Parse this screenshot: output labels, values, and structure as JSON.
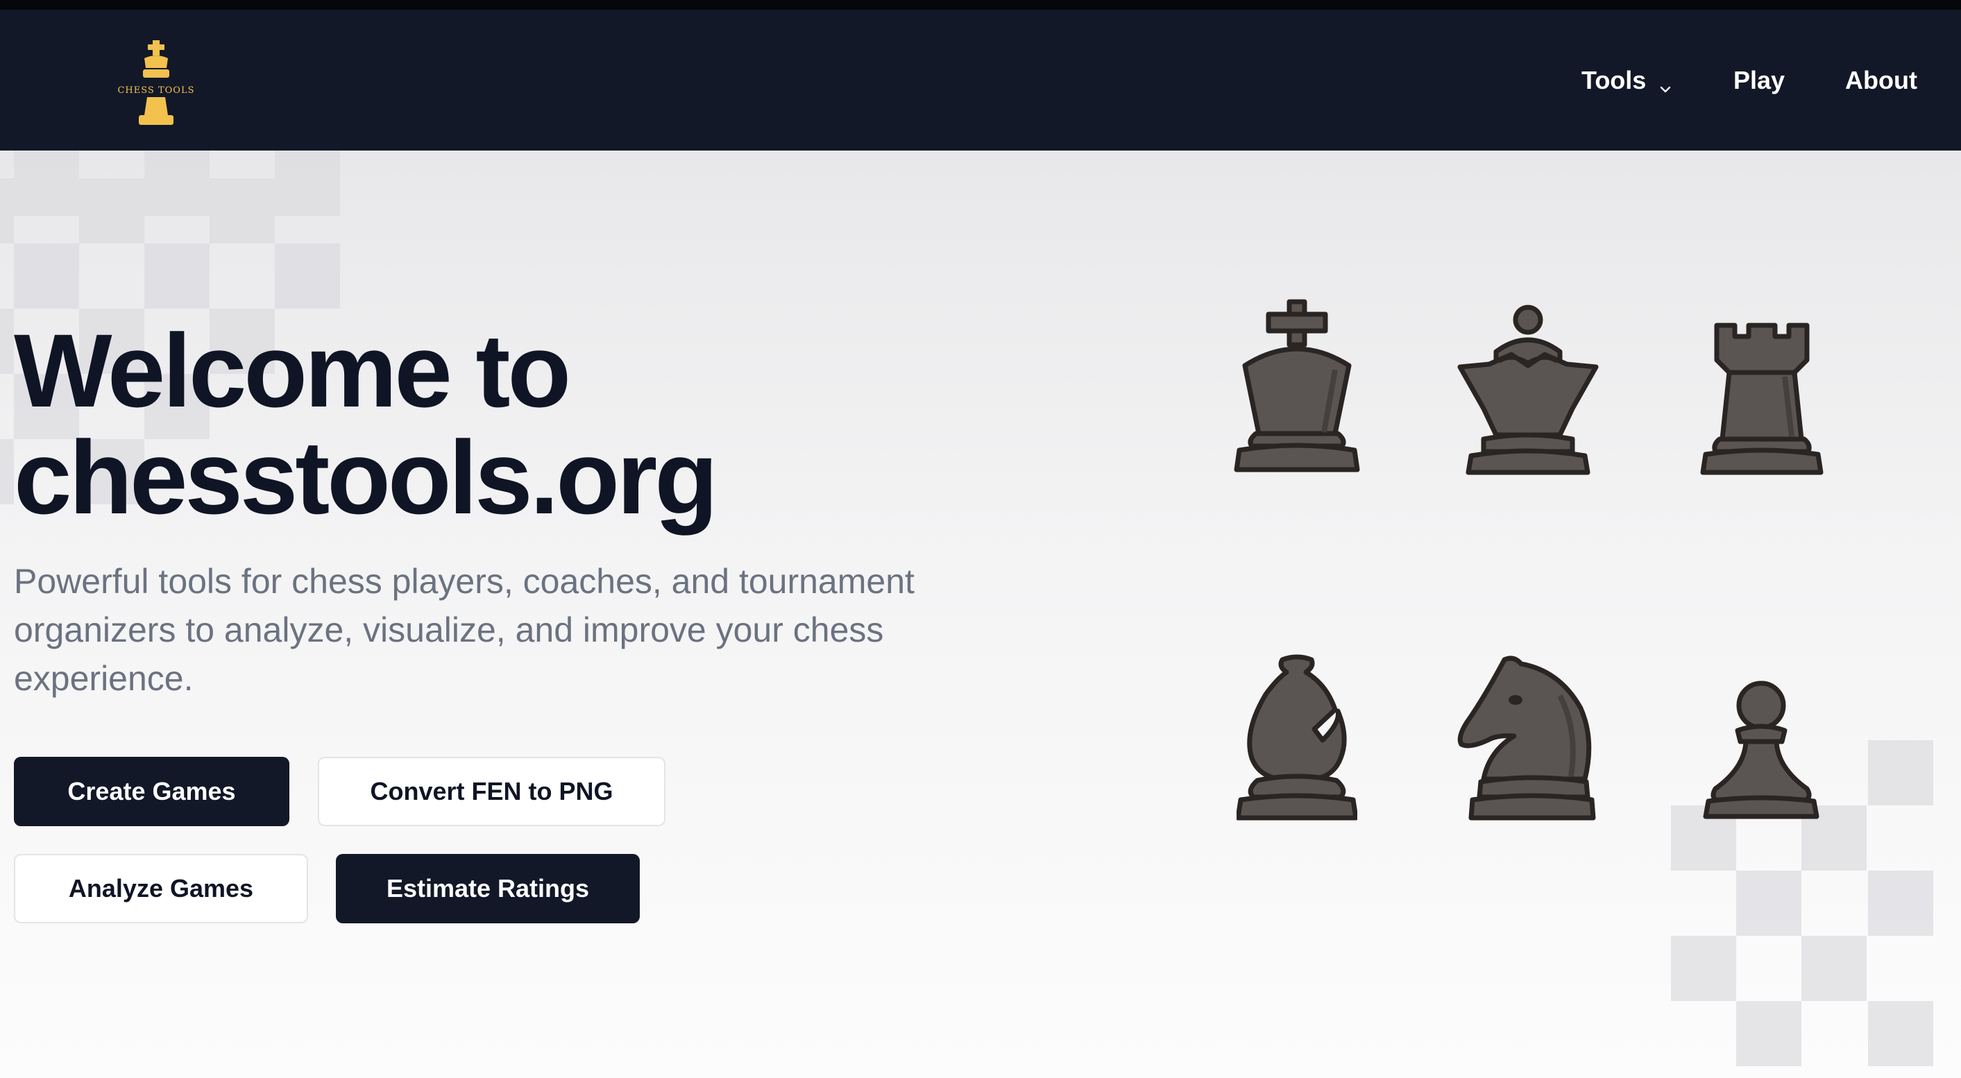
{
  "brand": {
    "logo_text": "CHESS TOOLS",
    "logo_icon": "king-logo-icon",
    "accent": "#f2c14e"
  },
  "nav": {
    "tools_label": "Tools",
    "play_label": "Play",
    "about_label": "About",
    "background": "#121828"
  },
  "hero": {
    "title_line1": "Welcome to",
    "title_line2": "chesstools.org",
    "subtitle": "Powerful tools for chess players, coaches, and tournament organizers to analyze, visualize, and improve your chess experience.",
    "buttons": {
      "create": "Create Games",
      "fen": "Convert FEN to PNG",
      "analyze": "Analyze Games",
      "estimate": "Estimate Ratings"
    },
    "pieces": [
      "king-icon",
      "queen-icon",
      "rook-icon",
      "bishop-icon",
      "knight-icon",
      "pawn-icon"
    ],
    "piece_color": "#5a5552"
  }
}
